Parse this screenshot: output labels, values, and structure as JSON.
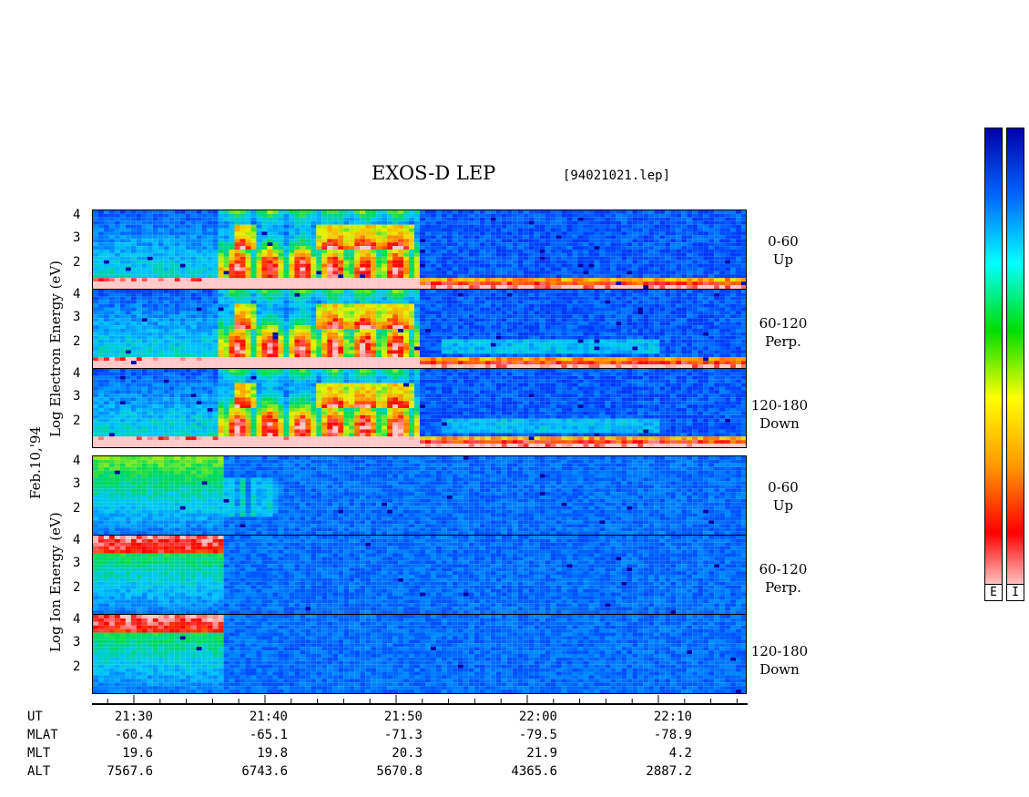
{
  "header": {
    "title": "EXOS-D LEP",
    "filename": "[94021021.lep]"
  },
  "date_label": "Feb.10,'94",
  "electron_label": [
    "Log",
    "Electron",
    "Energy",
    "(eV)"
  ],
  "ion_label": [
    "Log",
    "Ion",
    "Energy",
    "(eV)"
  ],
  "panels": [
    {
      "id": "e-up",
      "species": "Electron",
      "range": "0-60",
      "dir": "Up"
    },
    {
      "id": "e-perp",
      "species": "Electron",
      "range": "60-120",
      "dir": "Perp."
    },
    {
      "id": "e-down",
      "species": "Electron",
      "range": "120-180",
      "dir": "Down"
    },
    {
      "id": "i-up",
      "species": "Ion",
      "range": "0-60",
      "dir": "Up"
    },
    {
      "id": "i-perp",
      "species": "Ion",
      "range": "60-120",
      "dir": "Perp."
    },
    {
      "id": "i-down",
      "species": "Ion",
      "range": "120-180",
      "dir": "Down"
    }
  ],
  "colorbars": {
    "electron": "E",
    "ion": "I"
  },
  "chart_data": {
    "type": "heatmap",
    "title": "EXOS-D LEP",
    "y_ticks": [
      "4",
      "3",
      "2"
    ],
    "ylim": [
      1,
      4
    ],
    "y_scale": "log",
    "x_ticks": [
      "21:30",
      "21:40",
      "21:50",
      "22:00",
      "22:10"
    ],
    "footer_rows": [
      {
        "label": "UT",
        "values": [
          "21:30",
          "21:40",
          "21:50",
          "22:00",
          "22:10"
        ]
      },
      {
        "label": "MLAT",
        "values": [
          "-60.4",
          "-65.1",
          "-71.3",
          "-79.5",
          "-78.9"
        ]
      },
      {
        "label": "MLT",
        "values": [
          "19.6",
          "19.8",
          "20.3",
          "21.9",
          "4.2"
        ]
      },
      {
        "label": "ALT",
        "values": [
          "7567.6",
          "6743.6",
          "5670.8",
          "4365.6",
          "2887.2"
        ]
      }
    ],
    "colormap": [
      "#ffffff",
      "#ff0000",
      "#ff9900",
      "#ffff00",
      "#00dd00",
      "#00ffff",
      "#0066ff",
      "#0000aa"
    ]
  }
}
